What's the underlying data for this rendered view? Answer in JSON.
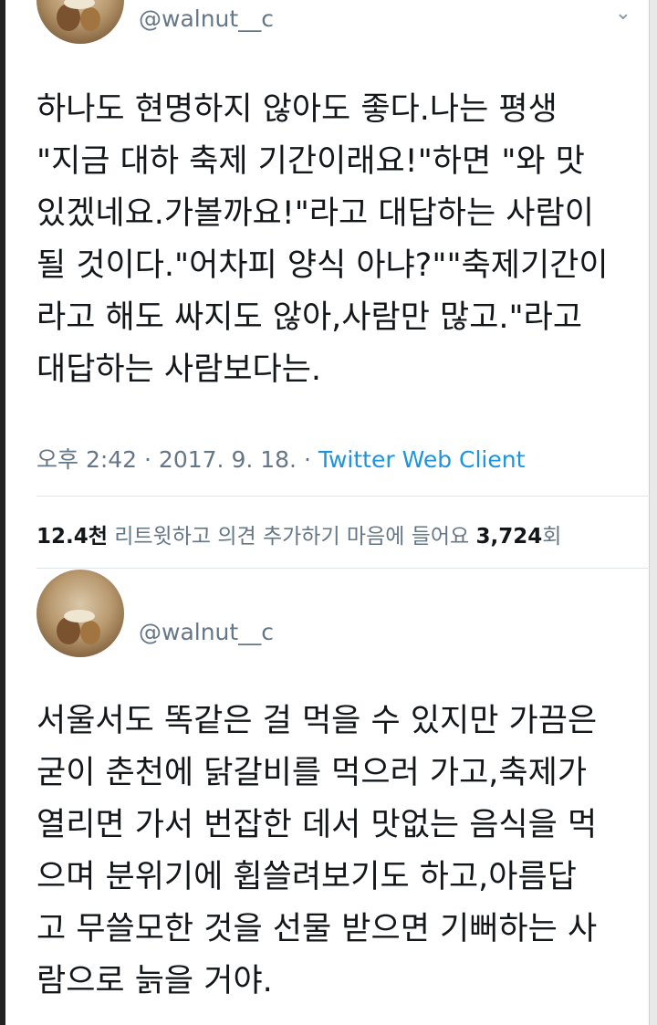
{
  "tweet1": {
    "handle": "@walnut__c",
    "text": "하나도 현명하지 않아도 좋다.나는 평생\n\"지금 대하 축제 기간이래요!\"하면 \"와 맛\n있겠네요.가볼까요!\"라고 대답하는 사람이\n될 것이다.\"어차피 양식 아냐?\"\"축제기간이\n라고 해도 싸지도 않아,사람만 많고.\"라고\n대답하는 사람보다는.",
    "timestamp": "오후 2:42 · 2017. 9. 18. · ",
    "client": "Twitter Web Client",
    "retweets_count": "12.4천",
    "retweets_label": " 리트윗하고 의견 추가하기  마음에 들어요 ",
    "likes_count": "3,724",
    "likes_unit": "회"
  },
  "tweet2": {
    "handle": "@walnut__c",
    "text": "서울서도 똑같은 걸 먹을 수 있지만 가끔은\n굳이 춘천에 닭갈비를 먹으러 가고,축제가\n열리면 가서 번잡한 데서 맛없는 음식을 먹\n으며 분위기에 휩쓸려보기도 하고,아름답\n고 무쓸모한 것을 선물 받으면 기뻐하는 사\n람으로 늙을 거야."
  },
  "icons": {
    "menu": "chevron-down-icon"
  }
}
